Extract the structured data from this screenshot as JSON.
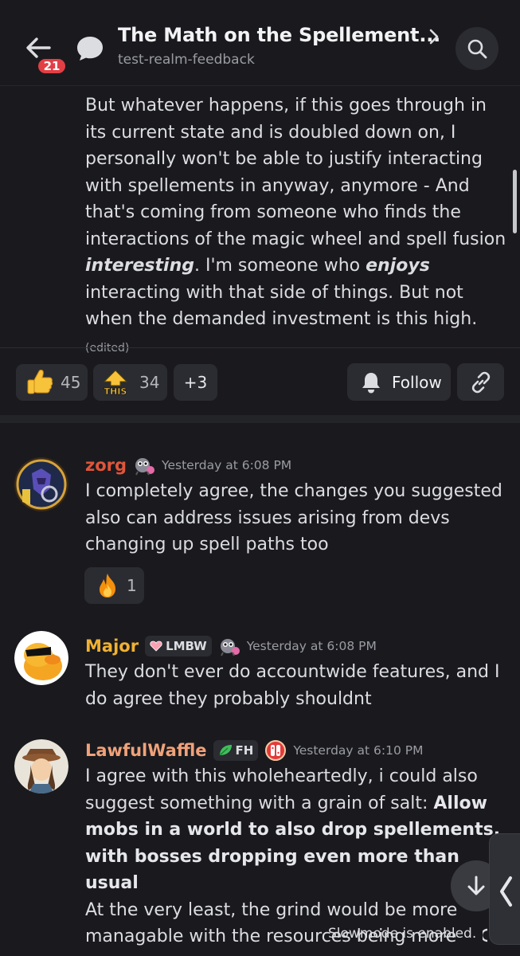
{
  "header": {
    "title": "The Math on the Spellement...",
    "subtitle": "test-realm-feedback",
    "badge_count": "21"
  },
  "top_message": {
    "text_1": "But whatever happens, if this goes through in its current state and is doubled down on, I personally won't be able to justify interacting with spellements in anyway, anymore - And that's coming from someone who finds the interactions of the magic wheel and spell fusion ",
    "emphasis_1": "interesting",
    "text_2": ". I'm someone who ",
    "emphasis_2": "enjoys",
    "text_3": " interacting with that side of things. But not when the demanded investment is this high. ",
    "edited": "(edited)"
  },
  "reactions": [
    {
      "emoji": "thumbs-up",
      "count": "45"
    },
    {
      "emoji": "this",
      "label": "THIS",
      "count": "34"
    },
    {
      "label": "+3"
    }
  ],
  "actions": {
    "follow_label": "Follow"
  },
  "messages": [
    {
      "username": "zorg",
      "name_color": "#e0553a",
      "timestamp": "Yesterday at 6:08 PM",
      "text": "I completely agree, the changes you suggested also can address issues arising from devs changing up spell paths too",
      "reaction": {
        "emoji": "fire",
        "count": "1"
      }
    },
    {
      "username": "Major",
      "name_color": "#f0b132",
      "tag": "LMBW",
      "timestamp": "Yesterday at 6:08 PM",
      "text": "They don't ever do accountwide features, and I do agree they probably shouldnt"
    },
    {
      "username": "LawfulWaffle",
      "name_color": "#f0a27a",
      "tag": "FH",
      "timestamp": "Yesterday at 6:10 PM",
      "text_1": "I agree with this wholeheartedly, i could also suggest something with a grain of salt: ",
      "bold": "Allow mobs in a world to also drop spellements, with bosses dropping even more than usual",
      "text_2": "At the very least, the grind would be more managable with the resources being more"
    }
  ],
  "footer": {
    "slowmode": "Slowmode is enabled."
  }
}
